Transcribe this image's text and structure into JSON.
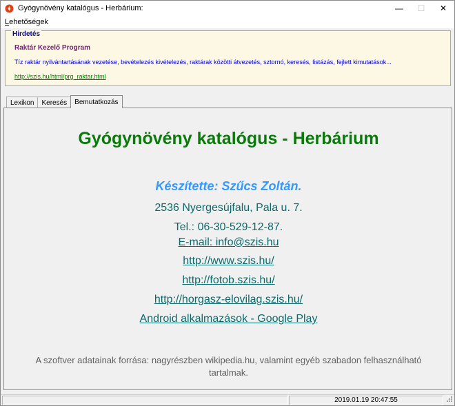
{
  "window": {
    "title": "Gyógynövény katalógus - Herbárium:",
    "minimize_glyph": "—",
    "maximize_glyph": "☐",
    "close_glyph": "✕"
  },
  "menu": {
    "item_first_letter": "L",
    "item_rest": "ehetőségek"
  },
  "ad": {
    "legend": "Hirdetés",
    "title": "Raktár Kezelő Program",
    "description": "Tíz raktár nyilvántartásának vezetése, bevételezés kivételezés, raktárak közötti átvezetés, sztornó, keresés, listázás, fejlett kimutatások...",
    "link": "http://szis.hu/html/prg_raktar.html"
  },
  "tabs": [
    {
      "label": "Lexikon"
    },
    {
      "label": "Keresés"
    },
    {
      "label": "Bemutatkozás",
      "active": true
    }
  ],
  "about": {
    "title": "Gyógynövény katalógus - Herbárium",
    "author": "Készítette: Szűcs Zoltán.",
    "address": "2536 Nyergesújfalu, Pala u. 7.",
    "phone": "Tel.: 06-30-529-12-87.",
    "email": "E-mail: info@szis.hu",
    "website": "http://www.szis.hu/",
    "photo_site": "http://fotob.szis.hu/",
    "fishing_site": "http://horgasz-elovilag.szis.hu/",
    "android": "Android alkalmazások - Google Play ",
    "source": "A szoftver adatainak forrása: nagyrészben wikipedia.hu, valamint egyéb szabadon felhasználható tartalmak."
  },
  "status": {
    "datetime": "2019.01.19 20:47:55"
  },
  "colors": {
    "title_green": "#0a7a0a",
    "author_blue": "#3399ff",
    "link_teal": "#0b6a6a",
    "ad_background": "#fdf8e4"
  }
}
